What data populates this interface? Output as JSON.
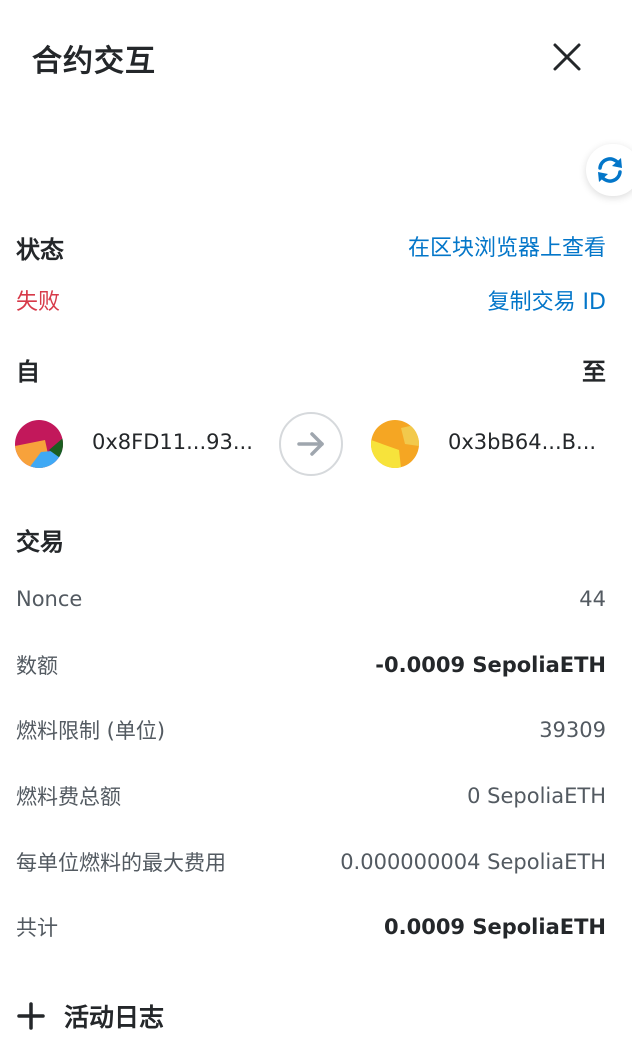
{
  "header": {
    "title": "合约交互",
    "close_icon": "close-icon"
  },
  "refresh_icon": "refresh-icon",
  "status": {
    "label": "状态",
    "value": "失败",
    "value_color": "#d73a49",
    "explorer_link": "在区块浏览器上查看",
    "copy_link": "复制交易 ID"
  },
  "transfer": {
    "from_label": "自",
    "to_label": "至",
    "from_address": "0x8FD11...93...",
    "to_address": "0x3bB64...B..."
  },
  "transaction": {
    "heading": "交易",
    "rows": [
      {
        "label": "Nonce",
        "value": "44"
      },
      {
        "label": "数额",
        "value": "-0.0009 SepoliaETH"
      },
      {
        "label": "燃料限制 (单位)",
        "value": "39309"
      },
      {
        "label": "燃料费总额",
        "value": "0 SepoliaETH"
      },
      {
        "label": "每单位燃料的最大费用",
        "value": "0.000000004 SepoliaETH"
      },
      {
        "label": "共计",
        "value": "0.0009 SepoliaETH"
      }
    ]
  },
  "activity_log": {
    "label": "活动日志",
    "icon": "plus-icon"
  },
  "colors": {
    "link": "#0376c9",
    "text": "#24272a",
    "muted": "#535a61",
    "error": "#d73a49"
  }
}
